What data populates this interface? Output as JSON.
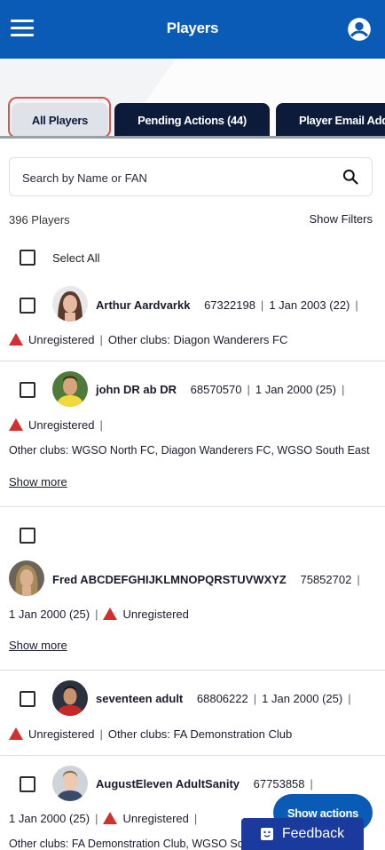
{
  "header": {
    "title": "Players",
    "menu_icon": "hamburger-menu-icon",
    "account_icon": "account-circle-icon"
  },
  "tabs": [
    {
      "label": "All Players",
      "active": true
    },
    {
      "label": "Pending Actions (44)",
      "active": false
    },
    {
      "label": "Player Email Add",
      "active": false
    }
  ],
  "search": {
    "placeholder": "Search by Name or FAN",
    "icon": "search-icon"
  },
  "summary": {
    "count": "396 Players",
    "filters_label": "Show Filters"
  },
  "select_all_label": "Select All",
  "players": [
    {
      "name": "Arthur Aardvarkk",
      "fan": "67322198",
      "dob": "1 Jan 2003 (22)",
      "status": "Unregistered",
      "other_clubs": "Other clubs: Diagon Wanderers FC"
    },
    {
      "name": "john DR ab DR",
      "fan": "68570570",
      "dob": "1 Jan 2000 (25)",
      "status": "Unregistered",
      "other_clubs": "Other clubs: WGSO North FC, Diagon Wanderers FC, WGSO South East",
      "show_more": "Show more"
    },
    {
      "name": "Fred ABCDEFGHIJKLMNOPQRSTUVWXYZ",
      "fan": "75852702",
      "dob": "1 Jan 2000 (25)",
      "status": "Unregistered",
      "show_more": "Show more"
    },
    {
      "name": "seventeen adult",
      "fan": "68806222",
      "dob": "1 Jan 2000 (25)",
      "status": "Unregistered",
      "other_clubs": "Other clubs: FA Demonstration Club"
    },
    {
      "name": "AugustEleven AdultSanity",
      "fan": "67753858",
      "dob": "1 Jan 2000 (25)",
      "status": "Unregistered",
      "other_clubs": "Other clubs: FA Demonstration Club, WGSO Sc"
    }
  ],
  "show_actions_label": "Show actions",
  "feedback_label": "Feedback",
  "colors": {
    "brand_blue": "#0a5bb5",
    "tab_dark": "#0d1b3a",
    "warning_red": "#d32f2f",
    "feedback_blue": "#1a3a9e",
    "highlight": "#d9534f"
  }
}
